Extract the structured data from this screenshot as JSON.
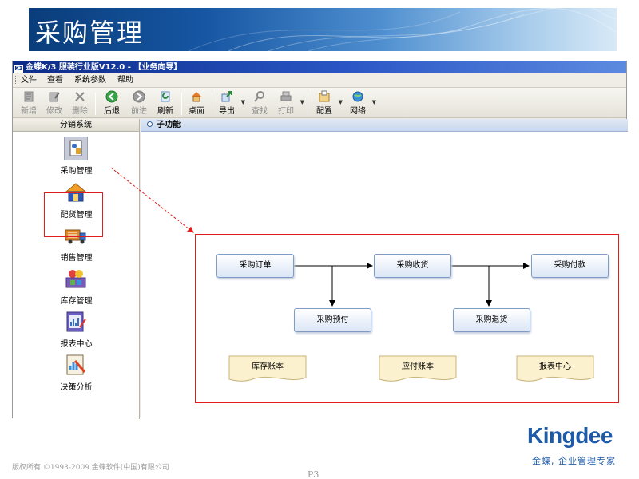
{
  "slide": {
    "title": "采购管理",
    "copyright": "版权所有 ©1993-2009 金蝶软件(中国)有限公司",
    "page": "P3",
    "logo": "Kingdee",
    "tagline": "金蝶, 企业管理专家"
  },
  "app": {
    "title": "金蝶K/3 服装行业版V12.0 - 【业务向导】",
    "menu": [
      "文件",
      "查看",
      "系统参数",
      "帮助"
    ],
    "toolbar": [
      {
        "label": "新增",
        "icon": "new-icon",
        "enabled": false
      },
      {
        "label": "修改",
        "icon": "edit-icon",
        "enabled": false
      },
      {
        "label": "删除",
        "icon": "delete-icon",
        "enabled": false
      },
      {
        "label": "后退",
        "icon": "back-icon",
        "enabled": true
      },
      {
        "label": "前进",
        "icon": "forward-icon",
        "enabled": false
      },
      {
        "label": "刷新",
        "icon": "refresh-icon",
        "enabled": true
      },
      {
        "label": "桌面",
        "icon": "desktop-icon",
        "enabled": true
      },
      {
        "label": "导出",
        "icon": "export-icon",
        "enabled": true
      },
      {
        "label": "查找",
        "icon": "find-icon",
        "enabled": false
      },
      {
        "label": "打印",
        "icon": "print-icon",
        "enabled": false
      },
      {
        "label": "配置",
        "icon": "config-icon",
        "enabled": true
      },
      {
        "label": "网络",
        "icon": "network-icon",
        "enabled": true
      }
    ],
    "sidebar": {
      "header": "分销系统",
      "items": [
        {
          "label": "采购管理",
          "icon": "purchase-icon",
          "selected": true
        },
        {
          "label": "配货管理",
          "icon": "house-icon"
        },
        {
          "label": "销售管理",
          "icon": "truck-icon"
        },
        {
          "label": "库存管理",
          "icon": "inventory-icon"
        },
        {
          "label": "报表中心",
          "icon": "report-icon"
        },
        {
          "label": "决策分析",
          "icon": "analysis-icon"
        }
      ]
    },
    "content": {
      "header": "子功能"
    },
    "flow": {
      "boxes": [
        "采购订单",
        "采购收货",
        "采购付款",
        "采购预付",
        "采购退货"
      ],
      "docs": [
        "库存账本",
        "应付账本",
        "报表中心"
      ]
    }
  },
  "colors": {
    "highlight": "#e21d1d",
    "title_bar": "#0b2b88",
    "brand": "#1d5aa8"
  }
}
